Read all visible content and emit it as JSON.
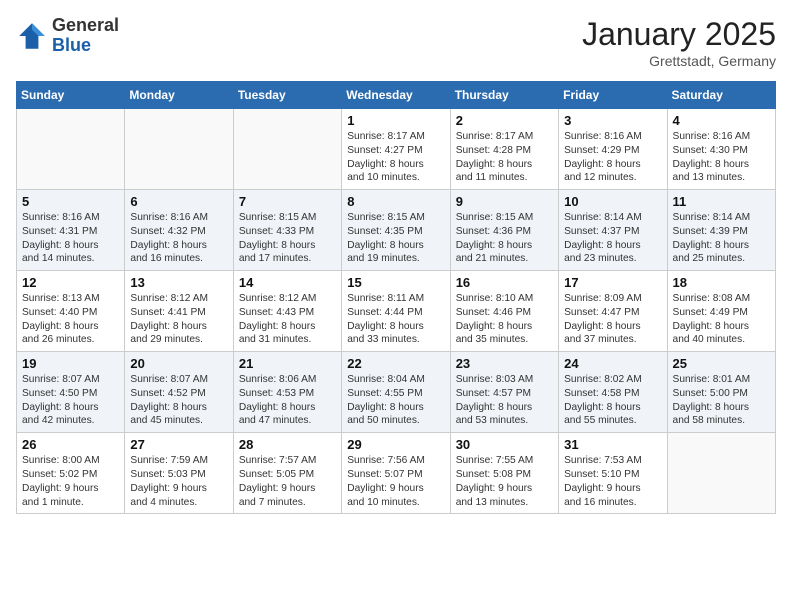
{
  "logo": {
    "general": "General",
    "blue": "Blue"
  },
  "title": {
    "month": "January 2025",
    "location": "Grettstadt, Germany"
  },
  "weekdays": [
    "Sunday",
    "Monday",
    "Tuesday",
    "Wednesday",
    "Thursday",
    "Friday",
    "Saturday"
  ],
  "weeks": [
    [
      {
        "num": "",
        "detail": ""
      },
      {
        "num": "",
        "detail": ""
      },
      {
        "num": "",
        "detail": ""
      },
      {
        "num": "1",
        "detail": "Sunrise: 8:17 AM\nSunset: 4:27 PM\nDaylight: 8 hours\nand 10 minutes."
      },
      {
        "num": "2",
        "detail": "Sunrise: 8:17 AM\nSunset: 4:28 PM\nDaylight: 8 hours\nand 11 minutes."
      },
      {
        "num": "3",
        "detail": "Sunrise: 8:16 AM\nSunset: 4:29 PM\nDaylight: 8 hours\nand 12 minutes."
      },
      {
        "num": "4",
        "detail": "Sunrise: 8:16 AM\nSunset: 4:30 PM\nDaylight: 8 hours\nand 13 minutes."
      }
    ],
    [
      {
        "num": "5",
        "detail": "Sunrise: 8:16 AM\nSunset: 4:31 PM\nDaylight: 8 hours\nand 14 minutes."
      },
      {
        "num": "6",
        "detail": "Sunrise: 8:16 AM\nSunset: 4:32 PM\nDaylight: 8 hours\nand 16 minutes."
      },
      {
        "num": "7",
        "detail": "Sunrise: 8:15 AM\nSunset: 4:33 PM\nDaylight: 8 hours\nand 17 minutes."
      },
      {
        "num": "8",
        "detail": "Sunrise: 8:15 AM\nSunset: 4:35 PM\nDaylight: 8 hours\nand 19 minutes."
      },
      {
        "num": "9",
        "detail": "Sunrise: 8:15 AM\nSunset: 4:36 PM\nDaylight: 8 hours\nand 21 minutes."
      },
      {
        "num": "10",
        "detail": "Sunrise: 8:14 AM\nSunset: 4:37 PM\nDaylight: 8 hours\nand 23 minutes."
      },
      {
        "num": "11",
        "detail": "Sunrise: 8:14 AM\nSunset: 4:39 PM\nDaylight: 8 hours\nand 25 minutes."
      }
    ],
    [
      {
        "num": "12",
        "detail": "Sunrise: 8:13 AM\nSunset: 4:40 PM\nDaylight: 8 hours\nand 26 minutes."
      },
      {
        "num": "13",
        "detail": "Sunrise: 8:12 AM\nSunset: 4:41 PM\nDaylight: 8 hours\nand 29 minutes."
      },
      {
        "num": "14",
        "detail": "Sunrise: 8:12 AM\nSunset: 4:43 PM\nDaylight: 8 hours\nand 31 minutes."
      },
      {
        "num": "15",
        "detail": "Sunrise: 8:11 AM\nSunset: 4:44 PM\nDaylight: 8 hours\nand 33 minutes."
      },
      {
        "num": "16",
        "detail": "Sunrise: 8:10 AM\nSunset: 4:46 PM\nDaylight: 8 hours\nand 35 minutes."
      },
      {
        "num": "17",
        "detail": "Sunrise: 8:09 AM\nSunset: 4:47 PM\nDaylight: 8 hours\nand 37 minutes."
      },
      {
        "num": "18",
        "detail": "Sunrise: 8:08 AM\nSunset: 4:49 PM\nDaylight: 8 hours\nand 40 minutes."
      }
    ],
    [
      {
        "num": "19",
        "detail": "Sunrise: 8:07 AM\nSunset: 4:50 PM\nDaylight: 8 hours\nand 42 minutes."
      },
      {
        "num": "20",
        "detail": "Sunrise: 8:07 AM\nSunset: 4:52 PM\nDaylight: 8 hours\nand 45 minutes."
      },
      {
        "num": "21",
        "detail": "Sunrise: 8:06 AM\nSunset: 4:53 PM\nDaylight: 8 hours\nand 47 minutes."
      },
      {
        "num": "22",
        "detail": "Sunrise: 8:04 AM\nSunset: 4:55 PM\nDaylight: 8 hours\nand 50 minutes."
      },
      {
        "num": "23",
        "detail": "Sunrise: 8:03 AM\nSunset: 4:57 PM\nDaylight: 8 hours\nand 53 minutes."
      },
      {
        "num": "24",
        "detail": "Sunrise: 8:02 AM\nSunset: 4:58 PM\nDaylight: 8 hours\nand 55 minutes."
      },
      {
        "num": "25",
        "detail": "Sunrise: 8:01 AM\nSunset: 5:00 PM\nDaylight: 8 hours\nand 58 minutes."
      }
    ],
    [
      {
        "num": "26",
        "detail": "Sunrise: 8:00 AM\nSunset: 5:02 PM\nDaylight: 9 hours\nand 1 minute."
      },
      {
        "num": "27",
        "detail": "Sunrise: 7:59 AM\nSunset: 5:03 PM\nDaylight: 9 hours\nand 4 minutes."
      },
      {
        "num": "28",
        "detail": "Sunrise: 7:57 AM\nSunset: 5:05 PM\nDaylight: 9 hours\nand 7 minutes."
      },
      {
        "num": "29",
        "detail": "Sunrise: 7:56 AM\nSunset: 5:07 PM\nDaylight: 9 hours\nand 10 minutes."
      },
      {
        "num": "30",
        "detail": "Sunrise: 7:55 AM\nSunset: 5:08 PM\nDaylight: 9 hours\nand 13 minutes."
      },
      {
        "num": "31",
        "detail": "Sunrise: 7:53 AM\nSunset: 5:10 PM\nDaylight: 9 hours\nand 16 minutes."
      },
      {
        "num": "",
        "detail": ""
      }
    ]
  ]
}
